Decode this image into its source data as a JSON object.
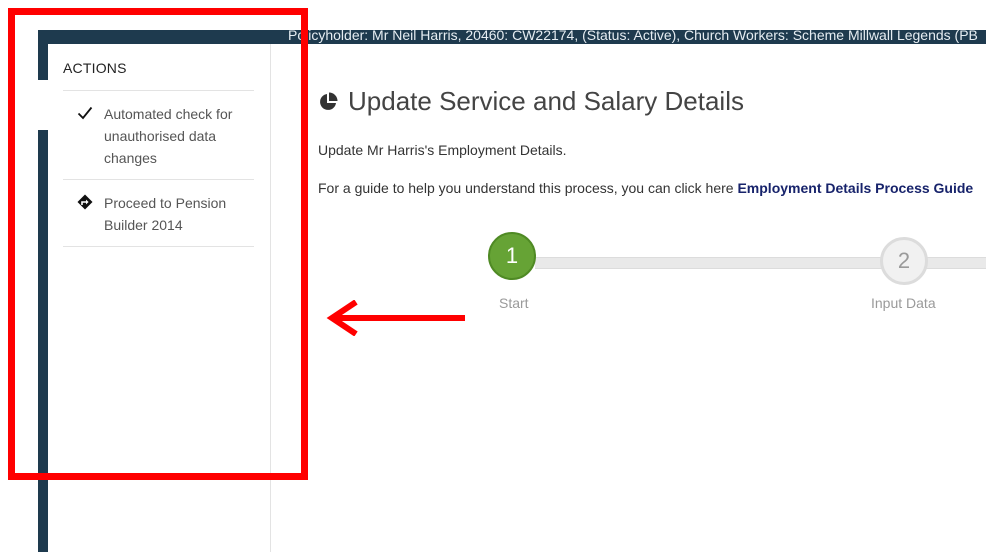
{
  "header": {
    "context_text": "Policyholder: Mr Neil Harris, 20460: CW22174, (Status: Active), Church Workers: Scheme Millwall Legends (PB"
  },
  "actions": {
    "title": "ACTIONS",
    "items": [
      {
        "label": "Automated check for unauthorised data changes",
        "icon": "checkmark-icon"
      },
      {
        "label": "Proceed to Pension Builder 2014",
        "icon": "direction-sign-icon"
      }
    ]
  },
  "main": {
    "title": "Update Service and Salary Details",
    "title_icon": "pie-chart-icon",
    "subtitle": "Update Mr Harris's Employment Details.",
    "guide_prefix": "For a guide to help you understand this process, you can click here ",
    "guide_link": "Employment Details Process Guide"
  },
  "stepper": {
    "current": 1,
    "steps": [
      {
        "number": "1",
        "label": "Start"
      },
      {
        "number": "2",
        "label": "Input Data"
      }
    ]
  },
  "colors": {
    "nav_dark": "#1e3a4e",
    "step_active": "#66a335",
    "link": "#17236b",
    "annotation": "#ff0000"
  }
}
